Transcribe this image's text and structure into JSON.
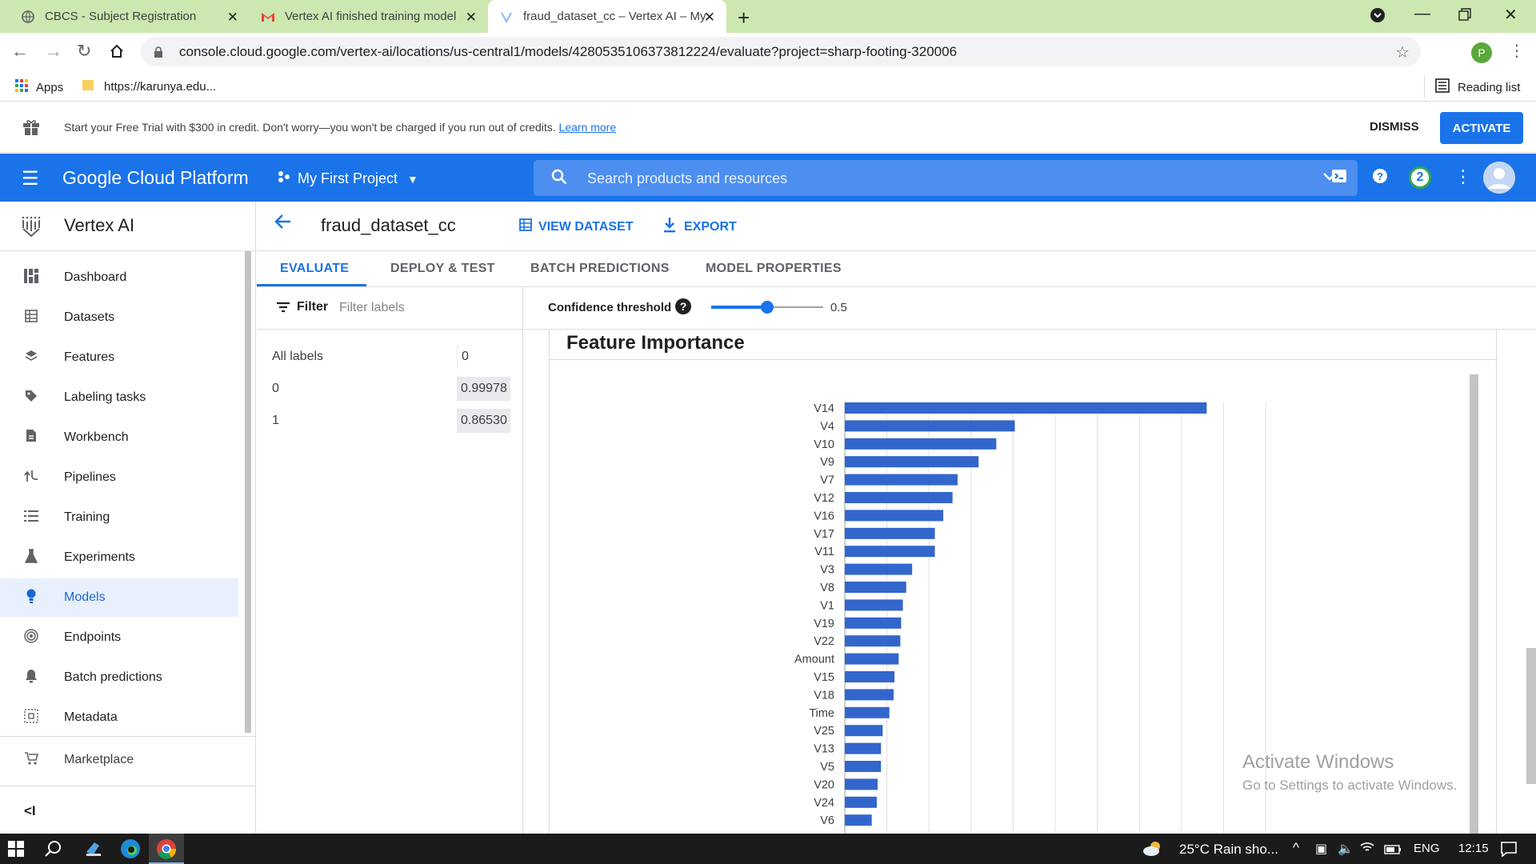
{
  "browser": {
    "tabs": [
      {
        "title": "CBCS - Subject Registration",
        "icon": "globe-icon",
        "active": false
      },
      {
        "title": "Vertex AI finished training model",
        "icon": "gmail-icon",
        "active": false
      },
      {
        "title": "fraud_dataset_cc – Vertex AI – My",
        "icon": "vertex-icon",
        "active": true
      }
    ],
    "url": "console.cloud.google.com/vertex-ai/locations/us-central1/models/4280535106373812224/evaluate?project=sharp-footing-320006",
    "profile_initial": "P",
    "bookmarks": {
      "apps": "Apps",
      "karunya": "https://karunya.edu...",
      "reading_list": "Reading list"
    }
  },
  "trial_banner": {
    "message": "Start your Free Trial with $300 in credit. Don't worry—you won't be charged if you run out of credits.",
    "learn_more": "Learn more",
    "dismiss": "DISMISS",
    "activate": "ACTIVATE"
  },
  "header": {
    "title": "Google Cloud Platform",
    "project": "My First Project",
    "search_placeholder": "Search products and resources",
    "notifications": "2"
  },
  "sidebar": {
    "title": "Vertex AI",
    "items": [
      {
        "label": "Dashboard",
        "icon": "dashboard-icon"
      },
      {
        "label": "Datasets",
        "icon": "datasets-icon"
      },
      {
        "label": "Features",
        "icon": "features-icon"
      },
      {
        "label": "Labeling tasks",
        "icon": "label-icon"
      },
      {
        "label": "Workbench",
        "icon": "workbench-icon"
      },
      {
        "label": "Pipelines",
        "icon": "pipelines-icon"
      },
      {
        "label": "Training",
        "icon": "training-icon"
      },
      {
        "label": "Experiments",
        "icon": "experiments-icon"
      },
      {
        "label": "Models",
        "icon": "models-icon",
        "active": true
      },
      {
        "label": "Endpoints",
        "icon": "endpoints-icon"
      },
      {
        "label": "Batch predictions",
        "icon": "bell-icon"
      },
      {
        "label": "Metadata",
        "icon": "metadata-icon"
      }
    ],
    "marketplace": "Marketplace"
  },
  "content": {
    "model_name": "fraud_dataset_cc",
    "view_dataset": "VIEW DATASET",
    "export": "EXPORT",
    "tabs": [
      "EVALUATE",
      "DEPLOY & TEST",
      "BATCH PREDICTIONS",
      "MODEL PROPERTIES"
    ],
    "filter_label": "Filter",
    "filter_placeholder": "Filter labels",
    "labels": [
      {
        "name": "All labels",
        "value": "0"
      },
      {
        "name": "0",
        "value": "0.99978"
      },
      {
        "name": "1",
        "value": "0.86530"
      }
    ],
    "confidence_label": "Confidence threshold",
    "confidence_value": "0.5",
    "confidence_fraction": 0.5,
    "feature_title": "Feature Importance"
  },
  "chart_data": {
    "type": "bar",
    "orientation": "horizontal",
    "title": "Feature Importance",
    "categories": [
      "V14",
      "V4",
      "V10",
      "V9",
      "V7",
      "V12",
      "V16",
      "V17",
      "V11",
      "V3",
      "V8",
      "V1",
      "V19",
      "V22",
      "Amount",
      "V15",
      "V18",
      "Time",
      "V25",
      "V13",
      "V5",
      "V20",
      "V24",
      "V6"
    ],
    "values": [
      0.43,
      0.202,
      0.18,
      0.159,
      0.134,
      0.128,
      0.117,
      0.107,
      0.107,
      0.08,
      0.073,
      0.069,
      0.067,
      0.066,
      0.064,
      0.059,
      0.058,
      0.053,
      0.045,
      0.043,
      0.043,
      0.039,
      0.038,
      0.032
    ],
    "xlim": [
      0,
      0.5
    ],
    "grid": true,
    "color": "#3366cc"
  },
  "watermark": {
    "line1": "Activate Windows",
    "line2": "Go to Settings to activate Windows."
  },
  "taskbar": {
    "weather": "25°C  Rain sho...",
    "language": "ENG",
    "time": "12:15"
  }
}
